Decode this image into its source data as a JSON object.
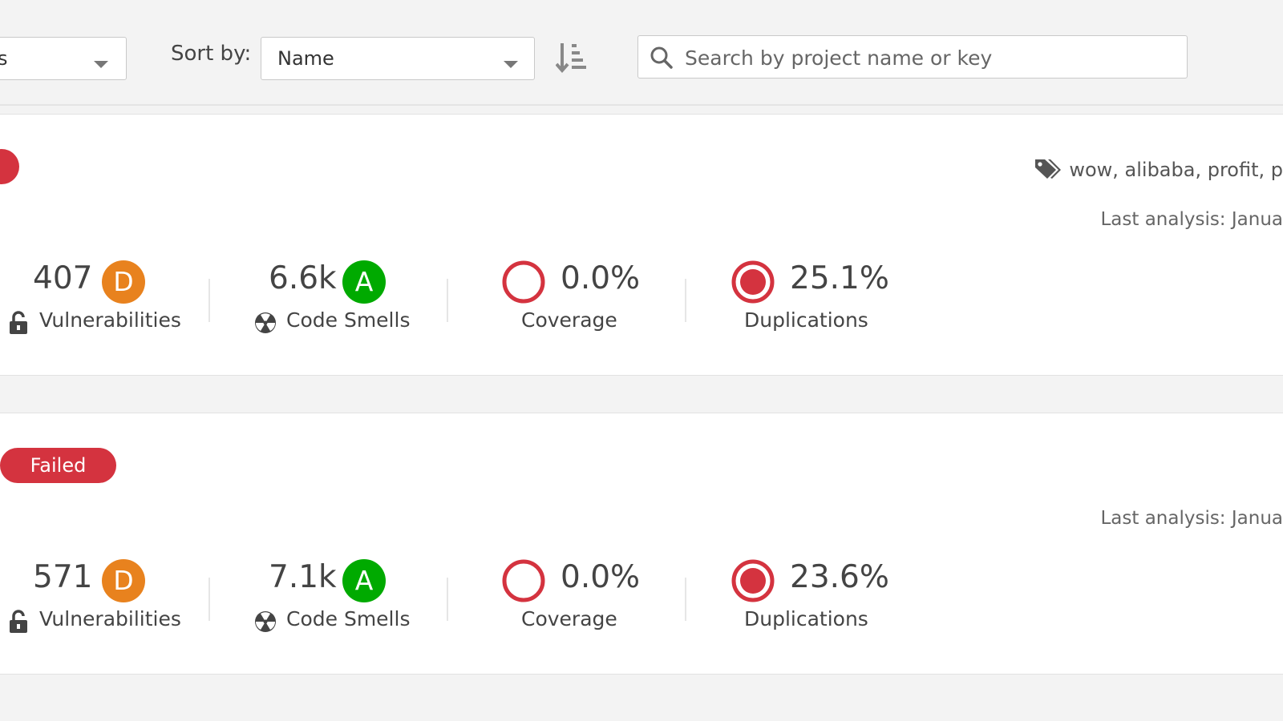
{
  "toolbar": {
    "filter_value": "s",
    "sort_label": "Sort by:",
    "sort_value": "Name",
    "search_placeholder": "Search by project name or key"
  },
  "colors": {
    "failed": "#d4333f",
    "rating_d": "#e8821e",
    "rating_a": "#00aa00",
    "coverage_ring": "#d4333f",
    "duplication_ring": "#d4333f"
  },
  "projects": [
    {
      "quality_gate": "",
      "tags": "wow, alibaba, profit, p",
      "last_analysis": "Last analysis: Janua",
      "vulnerabilities": {
        "value": "407",
        "rating": "D",
        "label": "Vulnerabilities"
      },
      "code_smells": {
        "value": "6.6k",
        "rating": "A",
        "label": "Code Smells"
      },
      "coverage": {
        "value": "0.0%",
        "label": "Coverage"
      },
      "duplications": {
        "value": "25.1%",
        "label": "Duplications"
      }
    },
    {
      "quality_gate": "Failed",
      "tags": "",
      "last_analysis": "Last analysis: Janua",
      "vulnerabilities": {
        "value": "571",
        "rating": "D",
        "label": "Vulnerabilities"
      },
      "code_smells": {
        "value": "7.1k",
        "rating": "A",
        "label": "Code Smells"
      },
      "coverage": {
        "value": "0.0%",
        "label": "Coverage"
      },
      "duplications": {
        "value": "23.6%",
        "label": "Duplications"
      }
    }
  ]
}
